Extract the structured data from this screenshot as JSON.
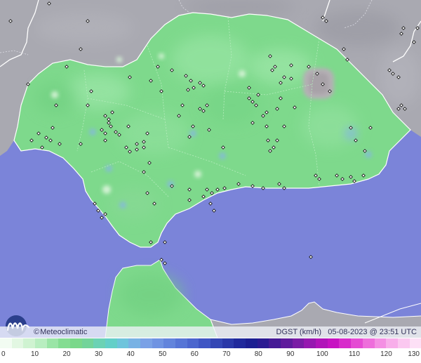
{
  "colors": {
    "sea": "#7b84d9",
    "land_outside": "#a9a9b1",
    "region_green": "#7ed98c",
    "gust_light": "#c9eecb",
    "gust_blue": "#85b5e6",
    "high_gust_gray": "#b5b0b5",
    "station_marker": "#1a1a1a",
    "border_line": "#ffffff"
  },
  "map": {
    "type": "weather-station gust map",
    "variable": "DGST",
    "units": "km/h"
  },
  "info_bar": {
    "credit_symbol": "©",
    "credit": "Meteoclimatic",
    "product": "DGST (km/h)",
    "timestamp": "05-08-2023 @ 23:51 UTC"
  },
  "legend": {
    "ticks": [
      "0",
      "10",
      "20",
      "30",
      "40",
      "50",
      "60",
      "70",
      "80",
      "90",
      "100",
      "110",
      "120",
      "130"
    ],
    "colors": [
      "#f2fcf2",
      "#e2f7e2",
      "#cff3d1",
      "#b8eec0",
      "#9ae5a6",
      "#84dd92",
      "#7ad88b",
      "#73d49a",
      "#6bd2b4",
      "#63cfc8",
      "#6ec4dc",
      "#78b2e4",
      "#7aa1e6",
      "#6f93e2",
      "#6284dc",
      "#5675d6",
      "#4b66ce",
      "#3f56c4",
      "#3447b5",
      "#2a38a8",
      "#20299c",
      "#1c1f92",
      "#2b1a92",
      "#451a96",
      "#5f1b9c",
      "#7a1ca5",
      "#9618b0",
      "#b114b9",
      "#c712c2",
      "#d82bcb",
      "#e54bd3",
      "#ee6edb",
      "#f48fe3",
      "#f8aeea",
      "#fbc8f0",
      "#fde0f6"
    ]
  }
}
